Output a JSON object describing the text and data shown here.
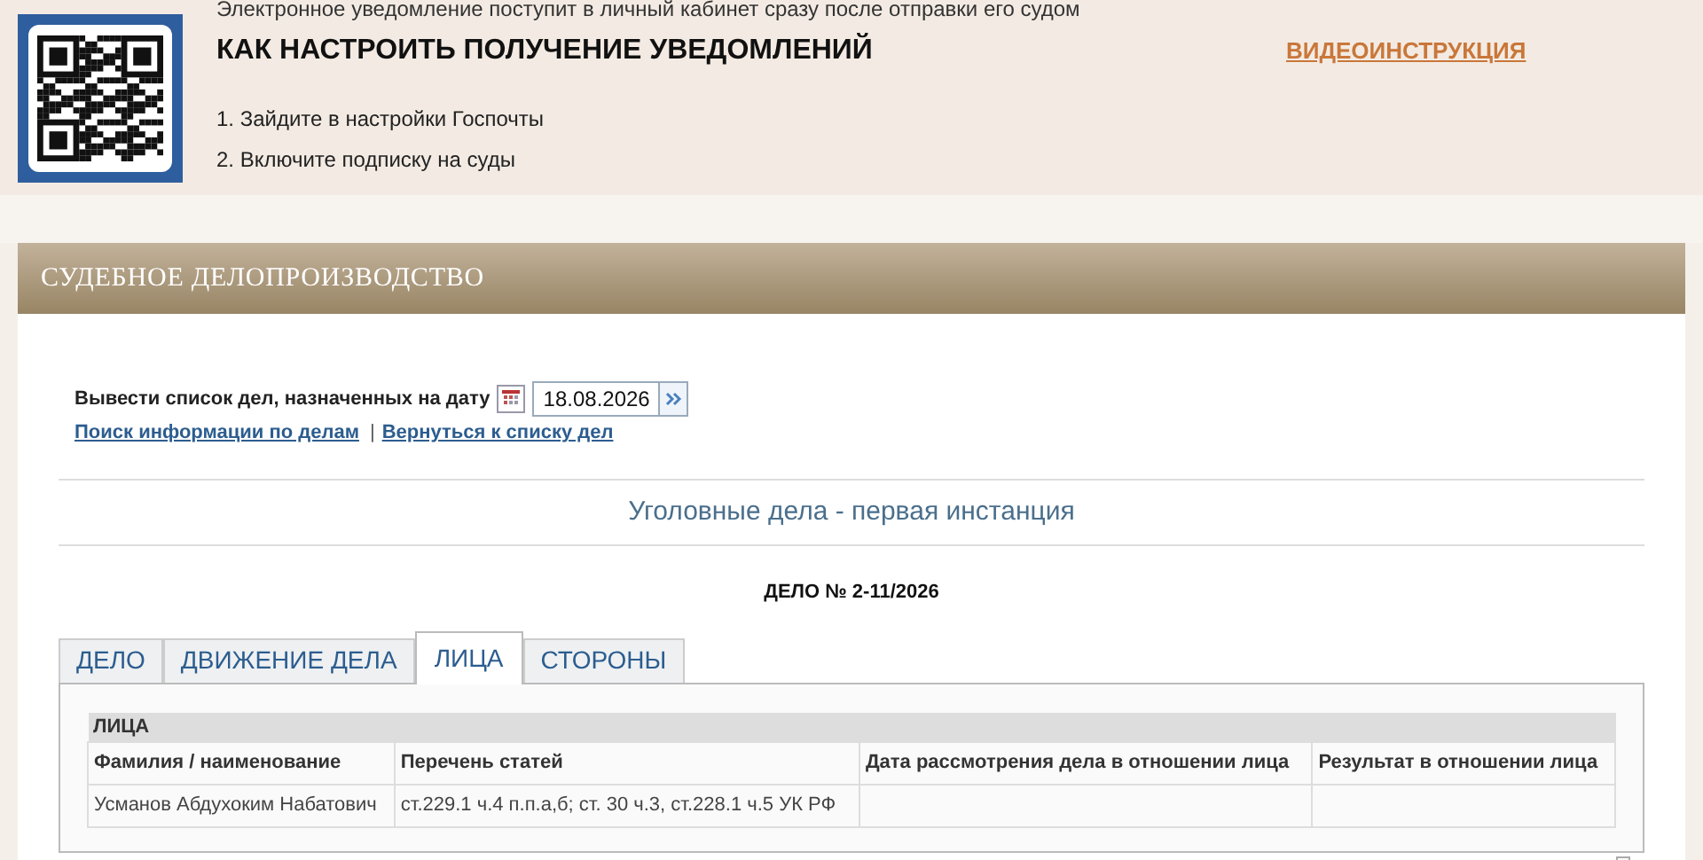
{
  "banner": {
    "note": "Электронное уведомление поступит в личный кабинет сразу после отправки его судом",
    "title": "КАК НАСТРОИТЬ ПОЛУЧЕНИЕ УВЕДОМЛЕНИЙ",
    "video_link": "ВИДЕОИНСТРУКЦИЯ",
    "steps": [
      "1. Зайдите в настройки Госпочты",
      "2. Включите подписку на суды"
    ]
  },
  "section": {
    "title": "СУДЕБНОЕ ДЕЛОПРОИЗВОДСТВО",
    "date_filter": {
      "label": "Вывести список дел, назначенных на дату",
      "value": "18.08.2026"
    },
    "links": [
      "Поиск информации по делам",
      "Вернуться к списку дел"
    ],
    "separator": "|",
    "category": "Уголовные дела - первая инстанция",
    "case_number": "ДЕЛО № 2-11/2026",
    "tabs": [
      {
        "label": "ДЕЛО",
        "selected": false
      },
      {
        "label": "ДВИЖЕНИЕ ДЕЛА",
        "selected": false
      },
      {
        "label": "ЛИЦА",
        "selected": true
      },
      {
        "label": "СТОРОНЫ",
        "selected": false
      }
    ],
    "table": {
      "caption": "ЛИЦА",
      "columns": [
        "Фамилия / наименование",
        "Перечень статей",
        "Дата рассмотрения дела в отношении лица",
        "Результат в отношении лица"
      ],
      "rows": [
        [
          "Усманов Абдухоким Набатович",
          "ст.229.1 ч.4 п.п.а,б; ст. 30 ч.3, ст.228.1 ч.5 УК РФ"
        ]
      ]
    }
  }
}
